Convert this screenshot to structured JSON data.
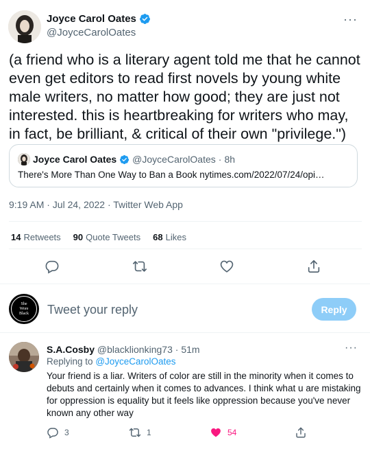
{
  "tweet": {
    "author_name": "Joyce Carol Oates",
    "author_handle": "@JoyceCarolOates",
    "more_label": "···",
    "text": "(a friend who is a literary agent told me that he cannot even get editors to read first novels by young white male writers, no matter how good; they are just not interested. this is heartbreaking for writers who may, in fact, be brilliant, & critical of their own \"privilege.\")",
    "timestamp": "9:19 AM · Jul 24, 2022 · Twitter Web App"
  },
  "quote": {
    "author_name": "Joyce Carol Oates",
    "author_handle": "@JoyceCarolOates",
    "separator": "·",
    "time": "8h",
    "text": "There's More Than One Way to Ban a Book nytimes.com/2022/07/24/opi…"
  },
  "stats": {
    "retweets_count": "14",
    "retweets_label": "Retweets",
    "quotes_count": "90",
    "quotes_label": "Quote Tweets",
    "likes_count": "68",
    "likes_label": "Likes"
  },
  "composer": {
    "avatar_lines": [
      "She",
      "Wore",
      "Black"
    ],
    "placeholder": "Tweet your reply",
    "button_label": "Reply"
  },
  "reply": {
    "author_name": "S.A.Cosby",
    "author_handle": "@blacklionking73",
    "separator": "·",
    "time": "51m",
    "more_label": "···",
    "replying_prefix": "Replying to",
    "replying_handle": "@JoyceCarolOates",
    "text": "Your friend is a liar. Writers of color are still in the minority when it comes to debuts and certainly when it comes to advances.  I think what u are mistaking for oppression is equality but it feels like oppression because you've never known any other way",
    "reply_count": "3",
    "retweet_count": "1",
    "like_count": "54"
  },
  "colors": {
    "accent": "#1d9bf0",
    "like": "#f91880",
    "muted": "#536471",
    "reply_button": "#8ecdf8"
  }
}
